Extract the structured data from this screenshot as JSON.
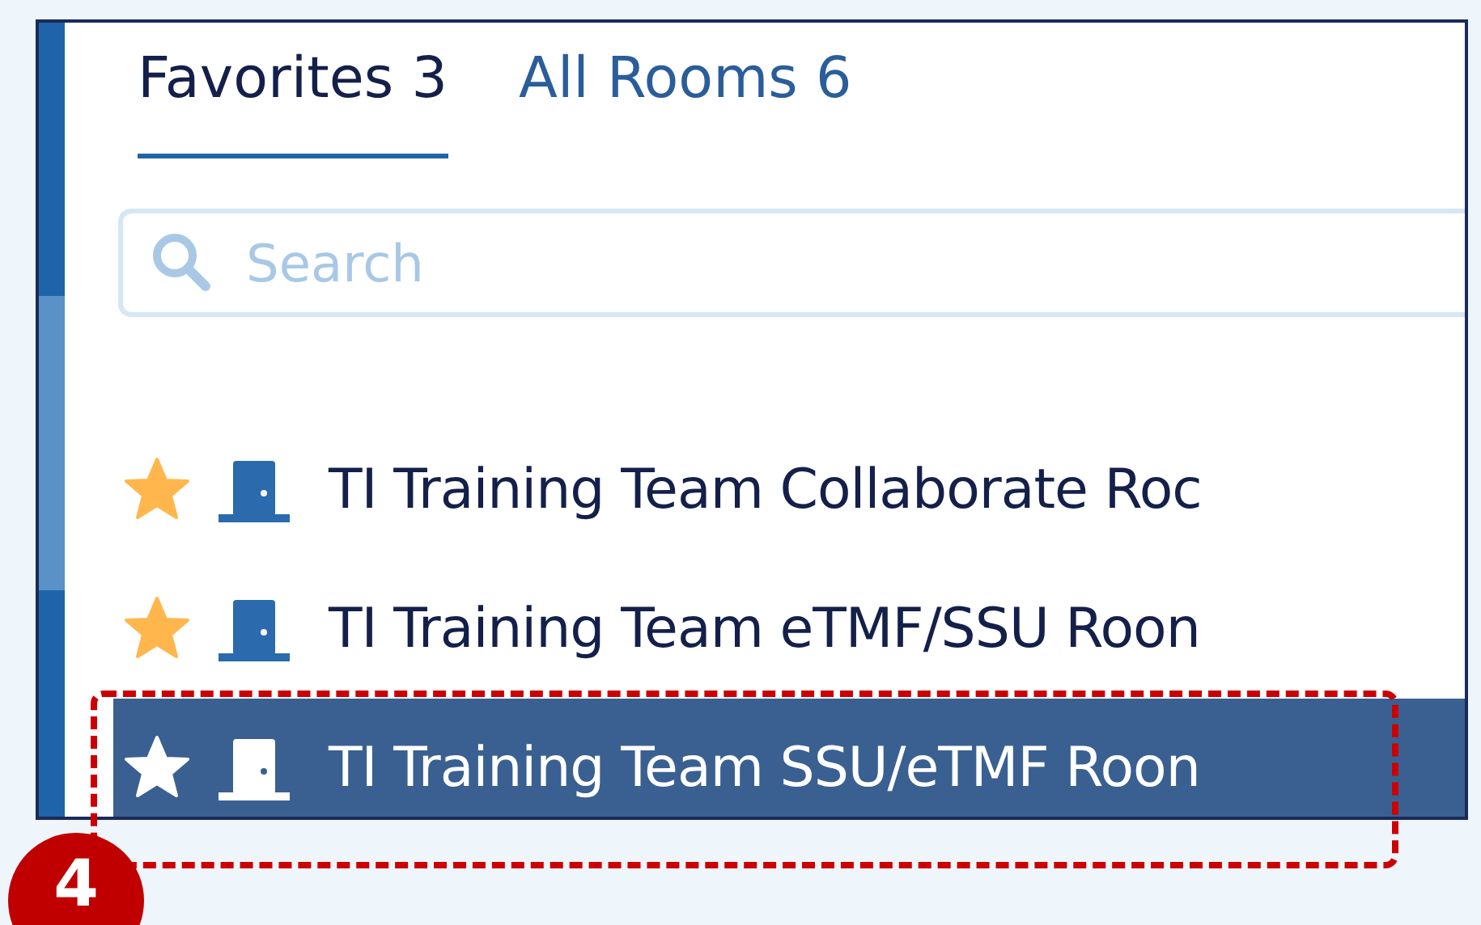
{
  "tabs": [
    {
      "label": "Favorites 3",
      "selected": true
    },
    {
      "label": "All Rooms 6",
      "selected": false
    }
  ],
  "search": {
    "placeholder": "Search"
  },
  "rooms": [
    {
      "name": "TI Training Team Collaborate Roc",
      "favorite": true,
      "selected": false
    },
    {
      "name": "TI Training Team eTMF/SSU Roon",
      "favorite": true,
      "selected": false
    },
    {
      "name": "TI Training Team SSU/eTMF Roon",
      "favorite": true,
      "selected": true
    }
  ],
  "annotation": {
    "label": "4"
  }
}
